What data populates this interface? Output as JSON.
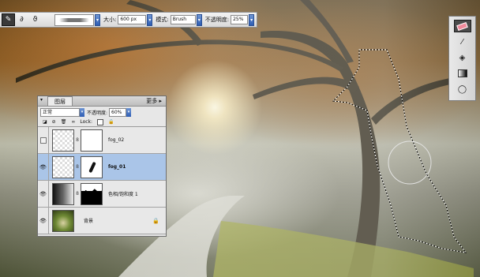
{
  "options_bar": {
    "size_label": "大小:",
    "size_value": "600 px",
    "mode_label": "模式:",
    "mode_value": "Brush",
    "opacity_label": "不透明度:",
    "opacity_value": "25%"
  },
  "tools": [
    "eraser-icon",
    "brush-icon",
    "paint-bucket-icon",
    "gradient-icon",
    "lasso-icon"
  ],
  "layers_panel": {
    "tab_label": "图层",
    "more_label": "更多",
    "blend_mode": "正常",
    "opacity_label": "不透明度:",
    "opacity_value": "60%",
    "lock_label": "Lock:",
    "layers": [
      {
        "name": "fog_02",
        "visible": false,
        "selected": false,
        "thumb": "layer",
        "mask": "white"
      },
      {
        "name": "fog_01",
        "visible": true,
        "selected": true,
        "thumb": "layer",
        "mask": "brushed"
      },
      {
        "name": "色相/饱和度 1",
        "visible": true,
        "selected": false,
        "thumb": "adjust",
        "mask": "black"
      },
      {
        "name": "背景",
        "visible": true,
        "selected": false,
        "thumb": "photo",
        "mask": "none",
        "locked": true
      }
    ]
  }
}
